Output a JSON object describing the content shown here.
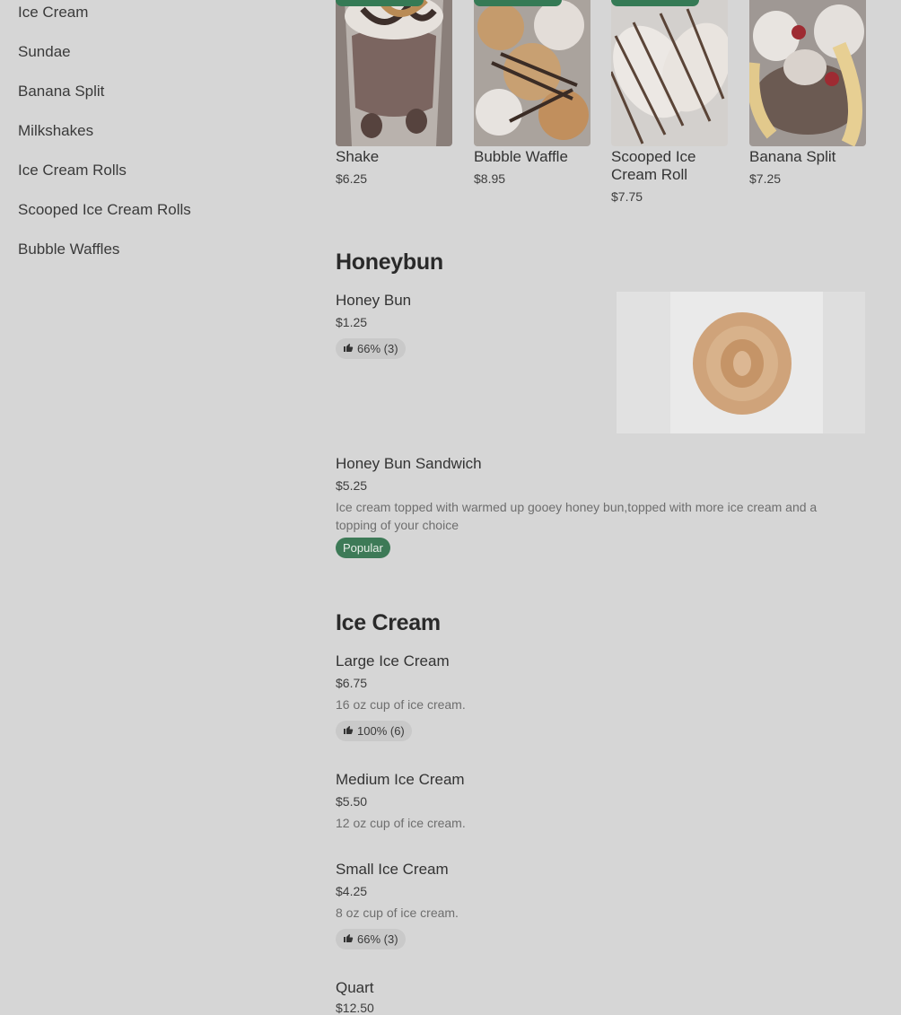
{
  "sidebar": {
    "items": [
      {
        "label": "Ice Cream"
      },
      {
        "label": "Sundae"
      },
      {
        "label": "Banana Split"
      },
      {
        "label": "Milkshakes"
      },
      {
        "label": "Ice Cream Rolls"
      },
      {
        "label": "Scooped Ice Cream Rolls"
      },
      {
        "label": "Bubble Waffles"
      }
    ]
  },
  "featured": [
    {
      "name": "Shake",
      "price": "$6.25",
      "image": "milkshake-photo"
    },
    {
      "name": "Bubble Waffle",
      "price": "$8.95",
      "image": "bubble-waffle-photo"
    },
    {
      "name": "Scooped Ice Cream Roll",
      "price": "$7.75",
      "image": "ice-cream-roll-photo"
    },
    {
      "name": "Banana Split",
      "price": "$7.25",
      "image": "banana-split-photo"
    }
  ],
  "sections": {
    "honeybun": {
      "title": "Honeybun",
      "items": [
        {
          "name": "Honey Bun",
          "price": "$1.25",
          "rating": "66% (3)",
          "image": "honey-bun-photo"
        },
        {
          "name": "Honey Bun Sandwich",
          "price": "$5.25",
          "description": "Ice cream topped with warmed up gooey honey bun,topped with more ice cream and a topping of your choice",
          "badge": "Popular"
        }
      ]
    },
    "ice_cream": {
      "title": "Ice Cream",
      "items": [
        {
          "name": "Large Ice Cream",
          "price": "$6.75",
          "description": "16 oz cup of ice cream.",
          "rating": "100% (6)"
        },
        {
          "name": "Medium Ice Cream",
          "price": "$5.50",
          "description": "12 oz cup of ice cream."
        },
        {
          "name": "Small Ice Cream",
          "price": "$4.25",
          "description": "8 oz cup of ice cream.",
          "rating": "66% (3)"
        },
        {
          "name": "Quart",
          "price": "$12.50"
        }
      ]
    }
  },
  "colors": {
    "background": "#d6d6d6",
    "accent_green": "#3d7a57",
    "chip": "#c9c9c9"
  },
  "icons": {
    "rating": "thumbs-up-icon"
  }
}
